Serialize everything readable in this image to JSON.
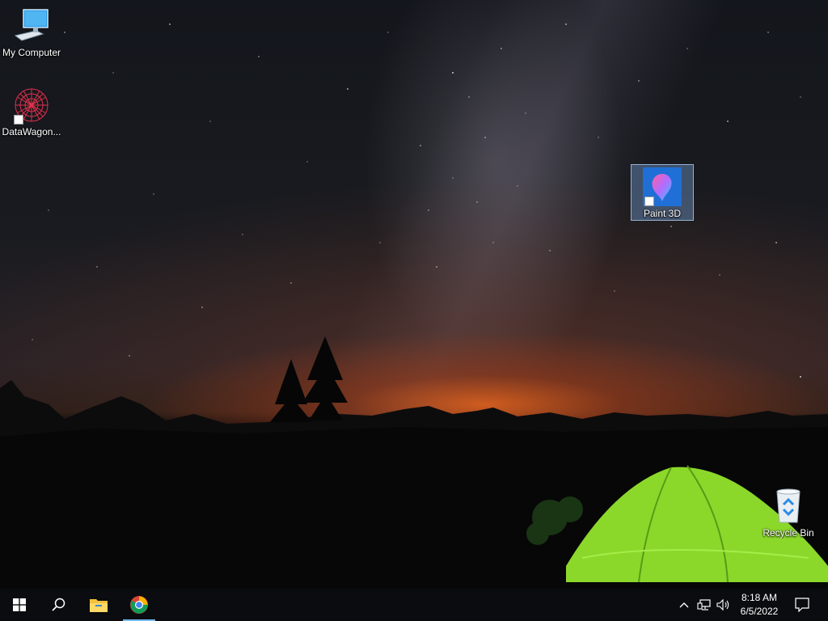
{
  "desktop": {
    "icons": [
      {
        "label": "My Computer",
        "icon": "computer-icon"
      },
      {
        "label": "DataWagon...",
        "icon": "datawagon-icon"
      },
      {
        "label": "Paint 3D",
        "icon": "paint3d-icon"
      },
      {
        "label": "Recycle Bin",
        "icon": "recycle-bin-icon"
      }
    ]
  },
  "taskbar": {
    "start": "windows-start-icon",
    "search": "search-icon",
    "apps": [
      {
        "name": "File Explorer",
        "icon": "folder-icon"
      },
      {
        "name": "Google Chrome",
        "icon": "chrome-icon"
      }
    ],
    "tray": [
      "chevron-up-icon",
      "network-icon",
      "volume-icon"
    ],
    "clock": {
      "time": "8:18 AM",
      "date": "6/5/2022"
    },
    "notifications": "action-center-icon"
  },
  "colors": {
    "taskbar": "#0b0c0f",
    "accent": "#76b9ed",
    "tent": "#8fe02a"
  }
}
